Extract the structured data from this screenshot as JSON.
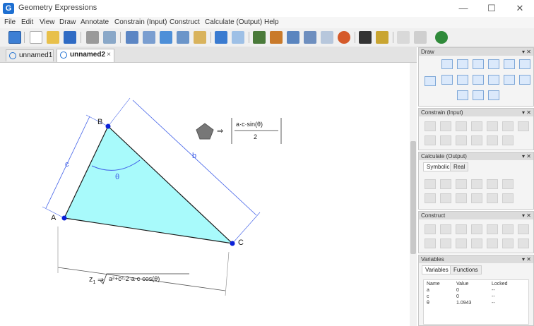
{
  "window": {
    "title": "Geometry Expressions",
    "minimize": "—",
    "maximize": "☐",
    "close": "✕"
  },
  "menu": [
    "File",
    "Edit",
    "View",
    "Draw",
    "Annotate",
    "Constrain (Input)",
    "Construct",
    "Calculate (Output)",
    "Help"
  ],
  "toolbar": {
    "icons": [
      "select-tool",
      "new-file",
      "open-file",
      "save-file",
      "print",
      "print-preview",
      "cut",
      "copy",
      "paste-special",
      "window",
      "clipboard",
      "undo",
      "redo",
      "zoom",
      "pan",
      "view-a",
      "view-b",
      "export",
      "ball",
      "grid",
      "pointer-pen",
      "page-a",
      "page-b",
      "help-globe"
    ]
  },
  "tabs": [
    {
      "label": "unnamed1",
      "active": false
    },
    {
      "label": "unnamed2",
      "active": true,
      "close": "×"
    }
  ],
  "drawing": {
    "points": {
      "A": "A",
      "B": "B",
      "C": "C"
    },
    "side_b": "b",
    "side_c": "c",
    "angle_label": "θ",
    "area_label_left": "⇒",
    "area_num": "a·c·sin(θ)",
    "area_den": "2",
    "length_lhs": "z",
    "length_sub": "1",
    "length_eq": "⇒",
    "length_expr": "a²+c²-2·a·c·cos(θ)"
  },
  "panels": {
    "draw": {
      "title": "Draw",
      "buttons": "▾ ✕"
    },
    "constrain": {
      "title": "Constrain (Input)",
      "buttons": "▾ ✕"
    },
    "calculate": {
      "title": "Calculate (Output)",
      "buttons": "▾ ✕",
      "tab1": "Symbolic",
      "tab2": "Real"
    },
    "construct": {
      "title": "Construct",
      "buttons": "▾ ✕"
    },
    "variables": {
      "title": "Variables",
      "buttons": "▾ ✕",
      "tab1": "Variables",
      "tab2": "Functions",
      "headers": [
        "Name",
        "Value",
        "Locked"
      ],
      "rows": [
        [
          "a",
          "0",
          "--"
        ],
        [
          "c",
          "0",
          "--"
        ],
        [
          "θ",
          "1.0943",
          "--"
        ]
      ]
    }
  },
  "colors": {
    "triangle_fill": "#a8fafb",
    "dimension": "#3f5fe8",
    "point": "#0a20d8",
    "accent": "#1d6fd1"
  }
}
